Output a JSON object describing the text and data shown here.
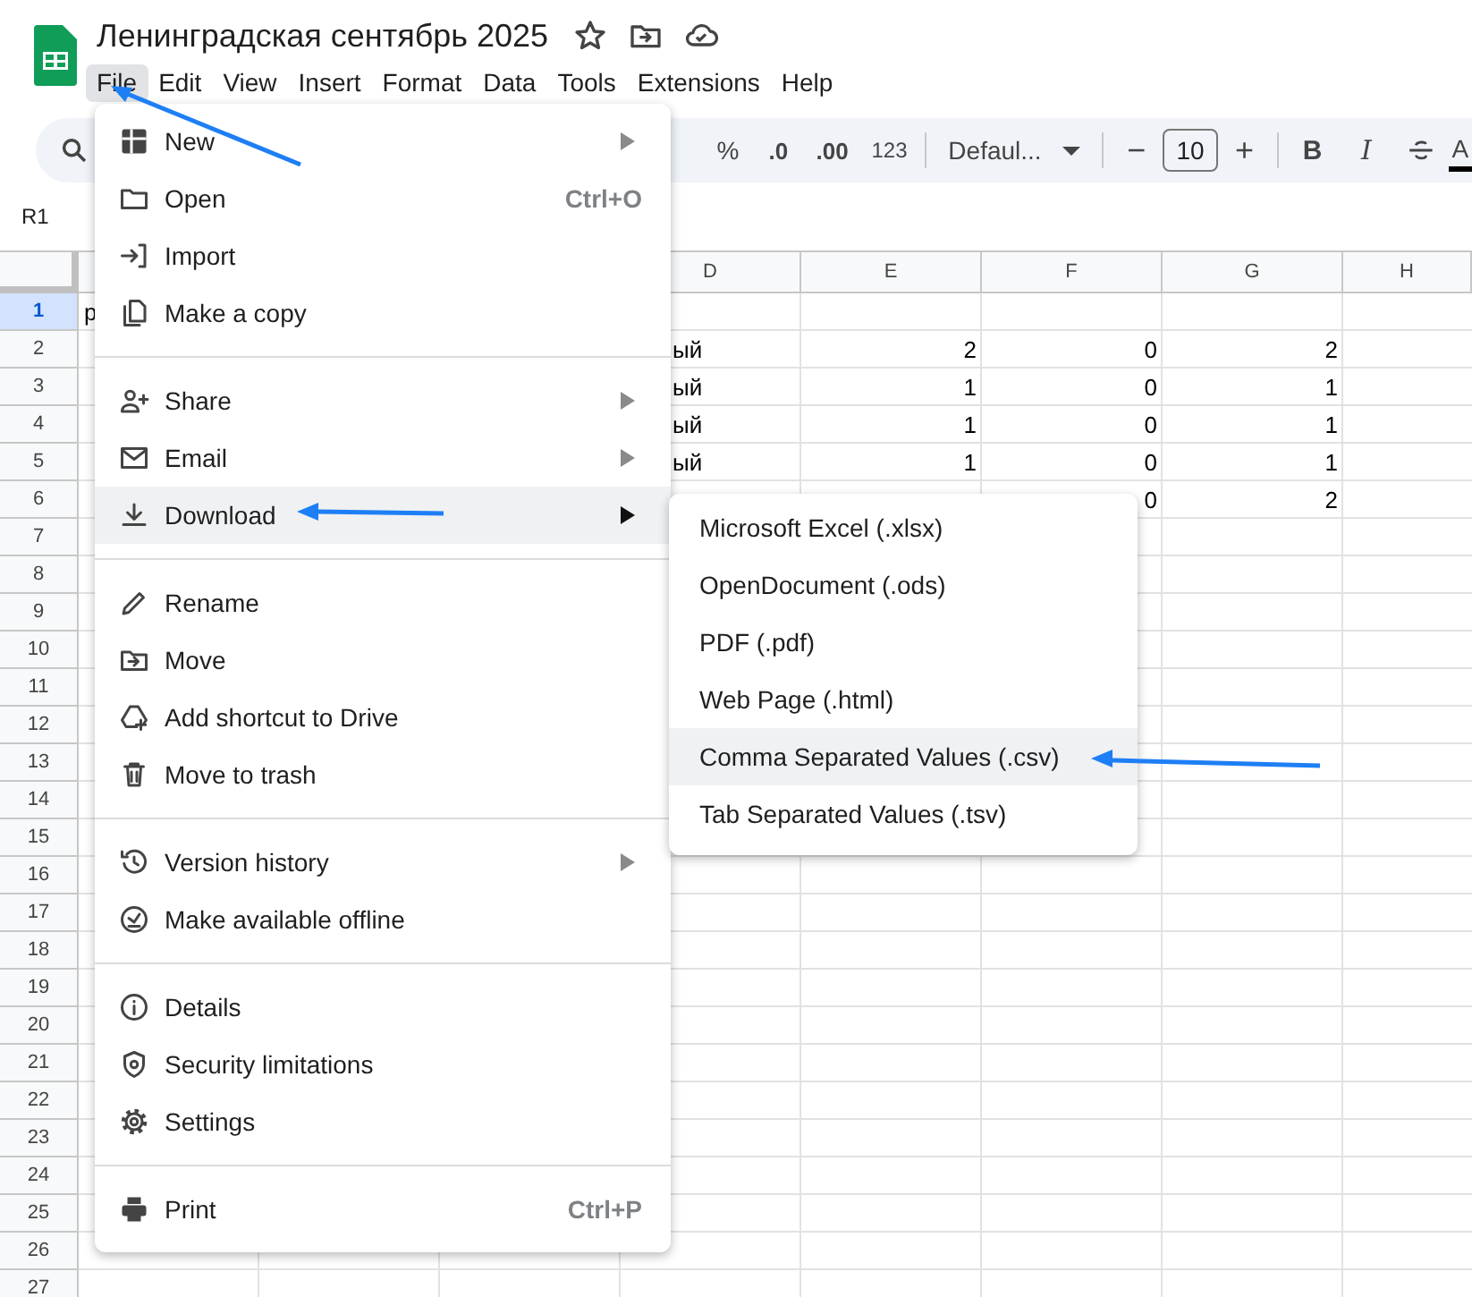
{
  "document": {
    "title": "Ленинградская сентябрь 2025"
  },
  "menu_bar": [
    {
      "label": "File",
      "selected": true
    },
    {
      "label": "Edit",
      "selected": false
    },
    {
      "label": "View",
      "selected": false
    },
    {
      "label": "Insert",
      "selected": false
    },
    {
      "label": "Format",
      "selected": false
    },
    {
      "label": "Data",
      "selected": false
    },
    {
      "label": "Tools",
      "selected": false
    },
    {
      "label": "Extensions",
      "selected": false
    },
    {
      "label": "Help",
      "selected": false
    }
  ],
  "toolbar": {
    "percent": "%",
    "decrease_decimals": ".0",
    "increase_decimals": ".00",
    "number_format": "123",
    "font": "Defaul...",
    "decrease_size": "−",
    "font_size": "10",
    "increase_size": "+",
    "bold": "B",
    "italic": "I",
    "text_color": "A"
  },
  "name_box": "R1",
  "columns": [
    "D",
    "E",
    "F",
    "G",
    "H"
  ],
  "rows": [
    {
      "number": "1",
      "selected": true,
      "cells": {
        "a": "р"
      }
    },
    {
      "number": "2",
      "selected": false,
      "cells": {
        "d": "ый",
        "e": "2",
        "f": "0",
        "g": "2"
      }
    },
    {
      "number": "3",
      "selected": false,
      "cells": {
        "d": "ый",
        "e": "1",
        "f": "0",
        "g": "1"
      }
    },
    {
      "number": "4",
      "selected": false,
      "cells": {
        "d": "ый",
        "e": "1",
        "f": "0",
        "g": "1"
      }
    },
    {
      "number": "5",
      "selected": false,
      "cells": {
        "d": "ый",
        "e": "1",
        "f": "0",
        "g": "1"
      }
    },
    {
      "number": "6",
      "selected": false,
      "cells": {
        "f": "0",
        "g": "2"
      }
    },
    {
      "number": "7",
      "selected": false
    },
    {
      "number": "8",
      "selected": false
    },
    {
      "number": "9",
      "selected": false
    },
    {
      "number": "10",
      "selected": false
    },
    {
      "number": "11",
      "selected": false
    },
    {
      "number": "12",
      "selected": false
    },
    {
      "number": "13",
      "selected": false
    },
    {
      "number": "14",
      "selected": false
    },
    {
      "number": "15",
      "selected": false
    },
    {
      "number": "16",
      "selected": false
    },
    {
      "number": "17",
      "selected": false
    },
    {
      "number": "18",
      "selected": false
    },
    {
      "number": "19",
      "selected": false
    },
    {
      "number": "20",
      "selected": false
    },
    {
      "number": "21",
      "selected": false
    },
    {
      "number": "22",
      "selected": false
    },
    {
      "number": "23",
      "selected": false
    },
    {
      "number": "24",
      "selected": false
    },
    {
      "number": "25",
      "selected": false
    },
    {
      "number": "26",
      "selected": false
    },
    {
      "number": "27",
      "selected": false
    }
  ],
  "file_menu": {
    "groups": [
      [
        {
          "label": "New",
          "submenu": true,
          "selected": false
        },
        {
          "label": "Open",
          "shortcut": "Ctrl+O",
          "submenu": false,
          "selected": false
        },
        {
          "label": "Import",
          "submenu": false,
          "selected": false
        },
        {
          "label": "Make a copy",
          "submenu": false,
          "selected": false
        }
      ],
      [
        {
          "label": "Share",
          "submenu": true,
          "selected": false
        },
        {
          "label": "Email",
          "submenu": true,
          "selected": false
        },
        {
          "label": "Download",
          "submenu": true,
          "selected": true
        }
      ],
      [
        {
          "label": "Rename",
          "submenu": false,
          "selected": false
        },
        {
          "label": "Move",
          "submenu": false,
          "selected": false
        },
        {
          "label": "Add shortcut to Drive",
          "submenu": false,
          "selected": false
        },
        {
          "label": "Move to trash",
          "submenu": false,
          "selected": false
        }
      ],
      [
        {
          "label": "Version history",
          "submenu": true,
          "selected": false
        },
        {
          "label": "Make available offline",
          "submenu": false,
          "selected": false
        }
      ],
      [
        {
          "label": "Details",
          "submenu": false,
          "selected": false
        },
        {
          "label": "Security limitations",
          "submenu": false,
          "selected": false
        },
        {
          "label": "Settings",
          "submenu": false,
          "selected": false
        }
      ],
      [
        {
          "label": "Print",
          "shortcut": "Ctrl+P",
          "submenu": false,
          "selected": false
        }
      ]
    ]
  },
  "download_menu": [
    {
      "label": "Microsoft Excel (.xlsx)",
      "selected": false
    },
    {
      "label": "OpenDocument (.ods)",
      "selected": false
    },
    {
      "label": "PDF (.pdf)",
      "selected": false
    },
    {
      "label": "Web Page (.html)",
      "selected": false
    },
    {
      "label": "Comma Separated Values (.csv)",
      "selected": true
    },
    {
      "label": "Tab Separated Values (.tsv)",
      "selected": false
    }
  ]
}
